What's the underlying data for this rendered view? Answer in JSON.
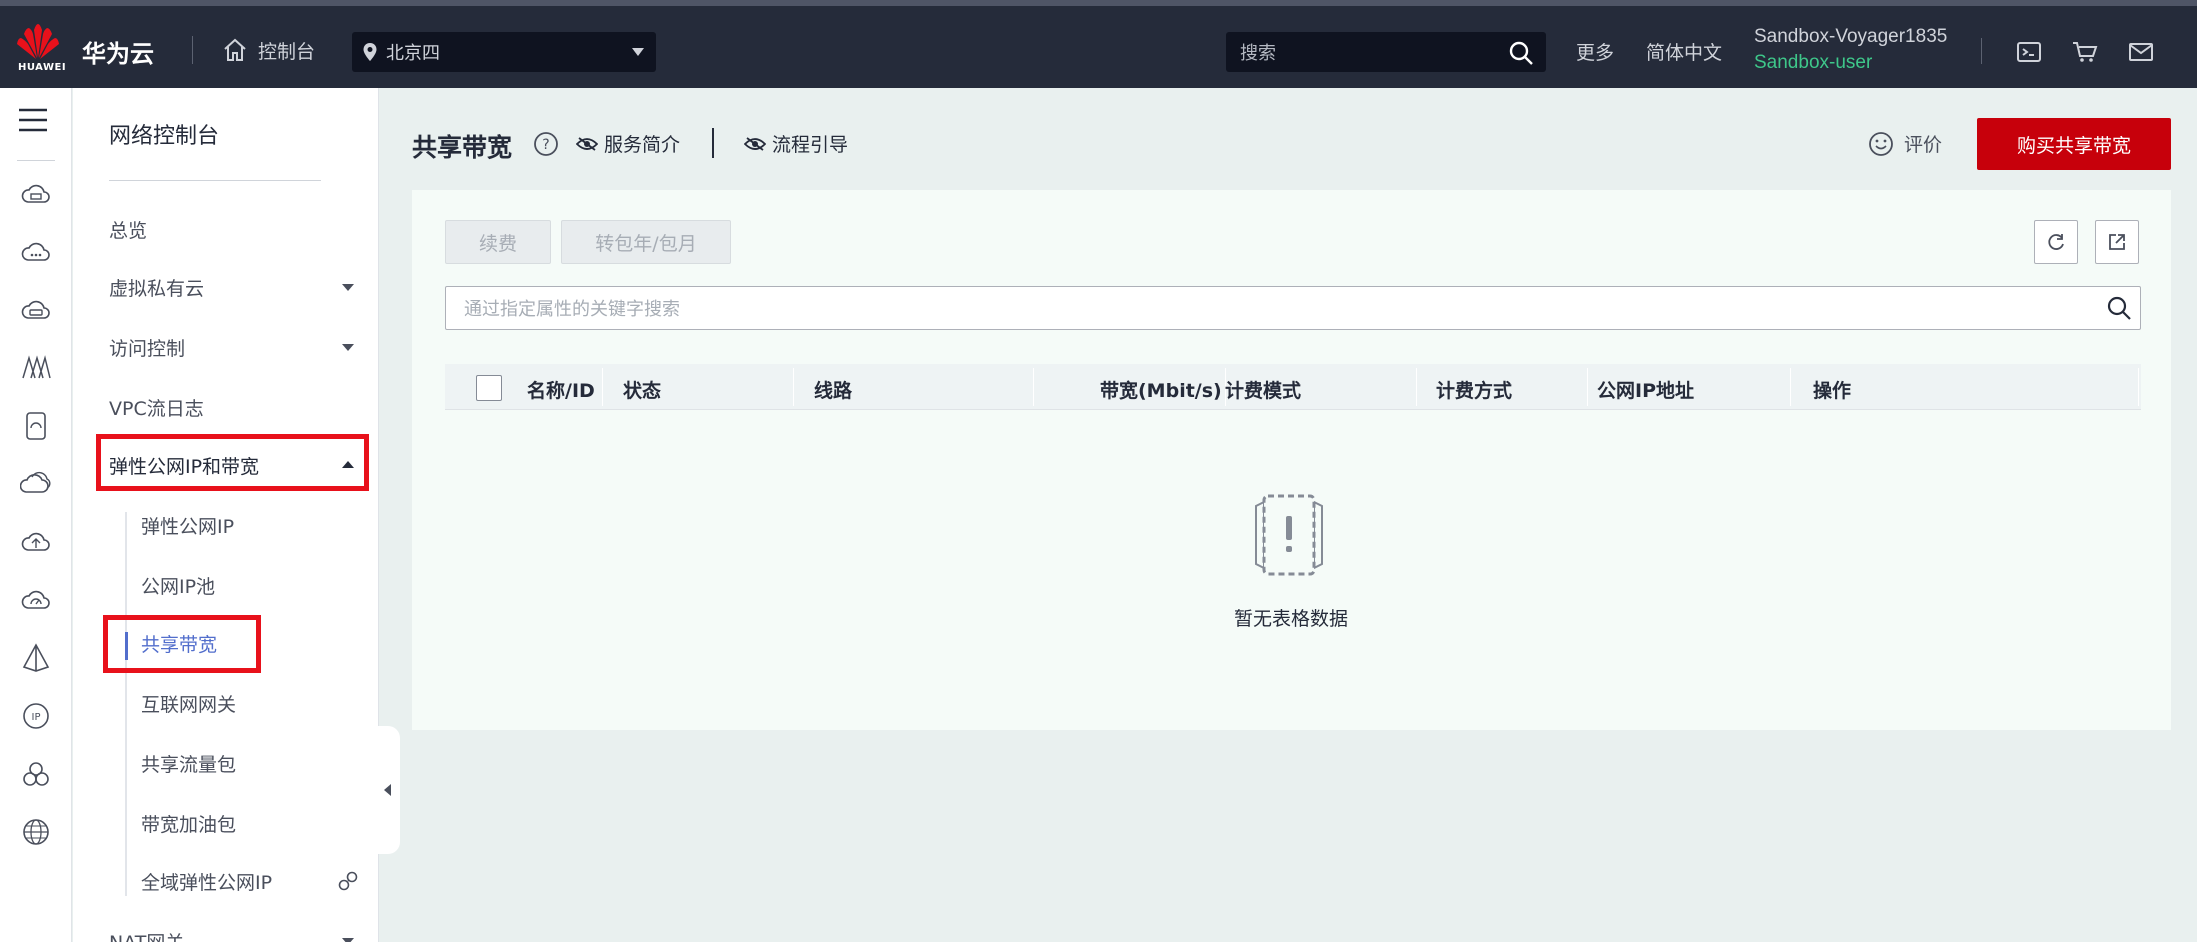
{
  "topbar": {
    "logo_text": "HUAWEI",
    "brand": "华为云",
    "console_label": "控制台",
    "region": "北京四",
    "search_placeholder": "搜索",
    "more": "更多",
    "language": "简体中文",
    "user_name": "Sandbox-Voyager1835",
    "user_role": "Sandbox-user"
  },
  "sidebar": {
    "title": "网络控制台",
    "items": [
      {
        "label": "总览"
      },
      {
        "label": "虚拟私有云"
      },
      {
        "label": "访问控制"
      },
      {
        "label": "VPC流日志"
      },
      {
        "label": "弹性公网IP和带宽"
      }
    ],
    "subitems": [
      {
        "label": "弹性公网IP"
      },
      {
        "label": "公网IP池"
      },
      {
        "label": "共享带宽"
      },
      {
        "label": "互联网网关"
      },
      {
        "label": "共享流量包"
      },
      {
        "label": "带宽加油包"
      },
      {
        "label": "全域弹性公网IP"
      }
    ],
    "next_item": "NAT网关"
  },
  "main": {
    "title": "共享带宽",
    "service_intro": "服务简介",
    "flow_guide": "流程引导",
    "rate": "评价",
    "buy_button": "购买共享带宽",
    "renew_button": "续费",
    "convert_button": "转包年/包月",
    "filter_placeholder": "通过指定属性的关键字搜索",
    "columns": [
      "名称/ID",
      "状态",
      "线路",
      "带宽(Mbit/s)",
      "计费模式",
      "计费方式",
      "公网IP地址",
      "操作"
    ],
    "empty_text": "暂无表格数据"
  },
  "colors": {
    "topbar_bg": "#252b3a",
    "buy_button": "#c7000b",
    "highlight_box": "#e8111b",
    "active_item": "#526ecc",
    "user_role": "#3ec78a"
  }
}
